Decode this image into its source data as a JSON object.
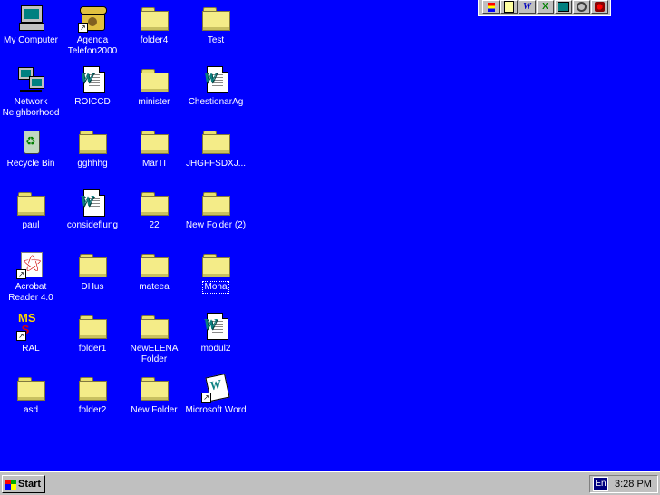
{
  "desktop": {
    "background": "#0000fe",
    "col1": [
      {
        "label": "My Computer"
      },
      {
        "label": "Network Neighborhood"
      },
      {
        "label": "Recycle Bin"
      },
      {
        "label": "paul"
      },
      {
        "label": "Acrobat Reader 4.0"
      },
      {
        "label": "RAL"
      },
      {
        "label": "asd"
      }
    ],
    "col2": [
      {
        "label": "Agenda Telefon2000"
      },
      {
        "label": "ROICCD"
      },
      {
        "label": "gghhhg"
      },
      {
        "label": "consideflung"
      },
      {
        "label": "DHus"
      },
      {
        "label": "folder1"
      },
      {
        "label": "folder2"
      }
    ],
    "col3": [
      {
        "label": "folder4"
      },
      {
        "label": "minister"
      },
      {
        "label": "MarTI"
      },
      {
        "label": "22"
      },
      {
        "label": "mateea"
      },
      {
        "label": "NewELENA Folder"
      },
      {
        "label": "New Folder"
      }
    ],
    "col4": [
      {
        "label": "Test"
      },
      {
        "label": "ChestionarAg"
      },
      {
        "label": "JHGFFSDXJ..."
      },
      {
        "label": "New Folder (2)"
      },
      {
        "label": "Mona"
      },
      {
        "label": "modul2"
      },
      {
        "label": "Microsoft Word"
      }
    ]
  },
  "taskbar": {
    "start_label": "Start",
    "language": "En",
    "clock": "3:28 PM"
  },
  "officebar": {
    "word_letter": "W",
    "excel_letter": "X"
  }
}
